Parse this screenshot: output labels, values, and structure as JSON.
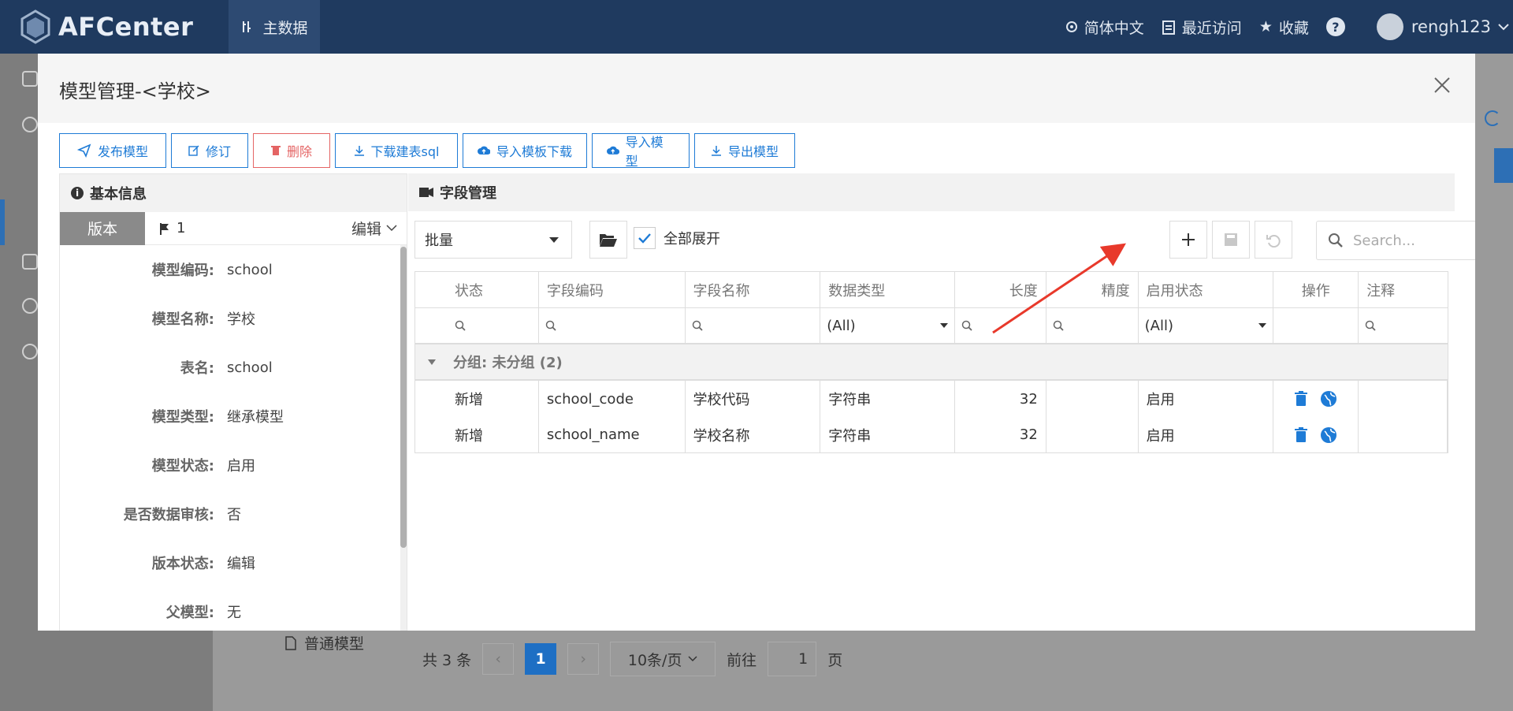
{
  "app": {
    "logo_text": "AFCenter",
    "nav_tab": "主数据",
    "lang": "简体中文",
    "recent": "最近访问",
    "favorites": "收藏",
    "help": "?",
    "user": "rengh123"
  },
  "background": {
    "model_item": "普通模型",
    "pager": {
      "total": "共 3 条",
      "current": "1",
      "page_size": "10条/页",
      "goto_label": "前往",
      "goto_value": "1",
      "page_unit": "页"
    }
  },
  "modal": {
    "title": "模型管理-<学校>",
    "toolbar": [
      {
        "label": "发布模型",
        "icon": "send-icon"
      },
      {
        "label": "修订",
        "icon": "edit-icon"
      },
      {
        "label": "删除",
        "icon": "trash-icon"
      },
      {
        "label": "下载建表sql",
        "icon": "download-icon"
      },
      {
        "label": "导入模板下载",
        "icon": "cloud-upload-icon"
      },
      {
        "label": "导入模型",
        "icon": "cloud-upload-icon"
      },
      {
        "label": "导出模型",
        "icon": "download-icon"
      }
    ],
    "basic_info": {
      "title": "基本信息",
      "version_label": "版本",
      "version_value": "1",
      "edit_label": "编辑",
      "fields": [
        {
          "key": "模型编码:",
          "value": "school"
        },
        {
          "key": "模型名称:",
          "value": "学校"
        },
        {
          "key": "表名:",
          "value": "school"
        },
        {
          "key": "模型类型:",
          "value": "继承模型"
        },
        {
          "key": "模型状态:",
          "value": "启用"
        },
        {
          "key": "是否数据审核:",
          "value": "否"
        },
        {
          "key": "版本状态:",
          "value": "编辑"
        },
        {
          "key": "父模型:",
          "value": "无"
        }
      ]
    },
    "field_mgmt": {
      "title": "字段管理",
      "batch": "批量",
      "expand_all": "全部展开",
      "expand_checked": true,
      "search_placeholder": "Search...",
      "columns": [
        "状态",
        "字段编码",
        "字段名称",
        "数据类型",
        "长度",
        "精度",
        "启用状态",
        "操作",
        "注释"
      ],
      "filter_all": "(All)",
      "group_label": "分组: 未分组 (2)",
      "rows": [
        {
          "status": "新增",
          "code": "school_code",
          "name": "学校代码",
          "type": "字符串",
          "length": "32",
          "precision": "",
          "enabled": "启用",
          "remark": ""
        },
        {
          "status": "新增",
          "code": "school_name",
          "name": "学校名称",
          "type": "字符串",
          "length": "32",
          "precision": "",
          "enabled": "启用",
          "remark": ""
        }
      ]
    }
  },
  "colors": {
    "accent": "#1e7bd6",
    "danger": "#e46464",
    "topbar": "#1f3a5f",
    "annotation_arrow": "#e8392b"
  }
}
